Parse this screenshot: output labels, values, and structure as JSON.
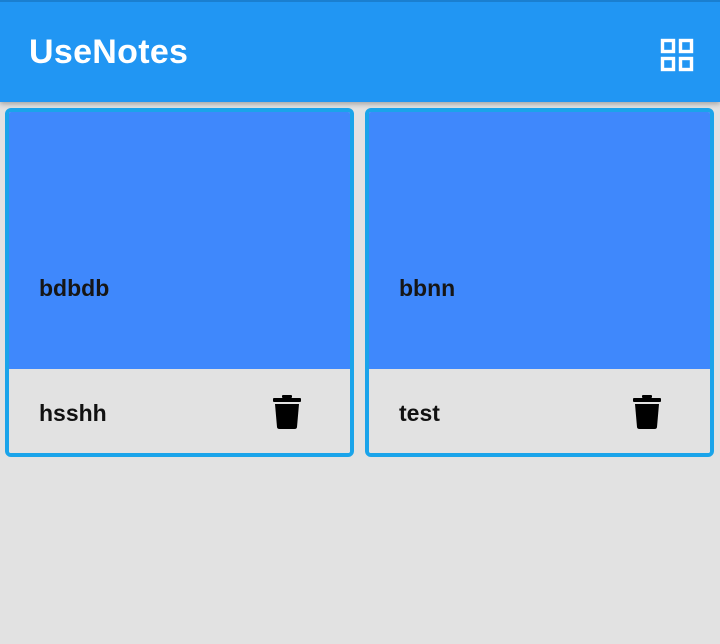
{
  "app": {
    "title": "UseNotes",
    "bar_color": "#2196f3",
    "layout_toggle_icon": "grid-view-icon"
  },
  "notes": [
    {
      "title": "bdbdb",
      "subtitle": "hsshh",
      "color": "#3f88fc",
      "delete_icon": "trash-icon"
    },
    {
      "title": "bbnn",
      "subtitle": "test",
      "color": "#3f88fc",
      "delete_icon": "trash-icon"
    }
  ],
  "colors": {
    "background": "#e2e2e2",
    "card_border": "#1aa4ea"
  }
}
